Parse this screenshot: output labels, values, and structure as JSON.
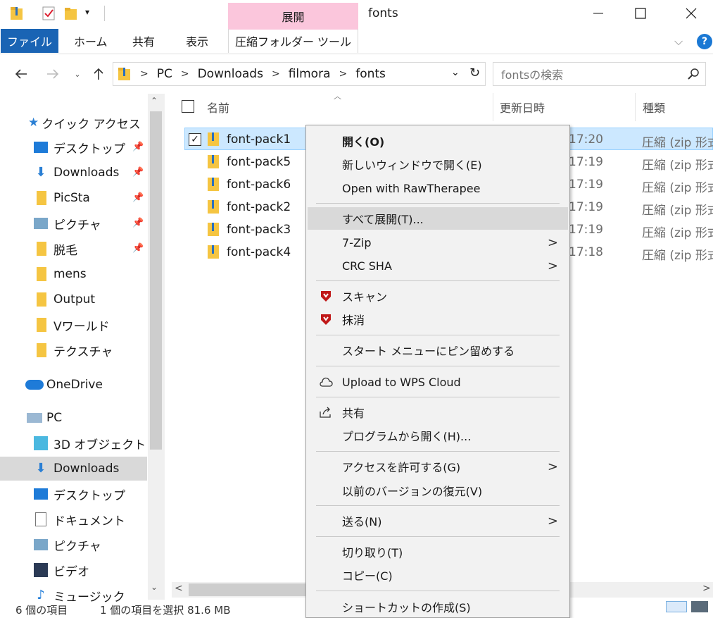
{
  "window": {
    "title": "fonts",
    "minimize": "—",
    "maximize": "☐",
    "close": "✕"
  },
  "ribbon": {
    "file_tab": "ファイル",
    "tabs": [
      "ホーム",
      "共有",
      "表示"
    ],
    "context_group": "展開",
    "context_tab": "圧縮フォルダー ツール",
    "help": "?"
  },
  "address": {
    "crumbs": [
      "PC",
      "Downloads",
      "filmora",
      "fonts"
    ],
    "search_placeholder": "fontsの検索"
  },
  "nav": {
    "quick_access": "クイック アクセス",
    "quick_items": [
      "デスクトップ",
      "Downloads",
      "PicSta",
      "ピクチャ",
      "脱毛",
      "mens",
      "Output",
      "Vワールド",
      "テクスチャ"
    ],
    "onedrive": "OneDrive",
    "pc": "PC",
    "pc_items": [
      "3D オブジェクト",
      "Downloads",
      "デスクトップ",
      "ドキュメント",
      "ピクチャ",
      "ビデオ",
      "ミュージック"
    ]
  },
  "list": {
    "columns": [
      "名前",
      "更新日時",
      "種類"
    ],
    "files": [
      {
        "name": "font-pack1",
        "time": "17:20",
        "type": "圧縮 (zip 形式"
      },
      {
        "name": "font-pack5",
        "time": "17:19",
        "type": "圧縮 (zip 形式"
      },
      {
        "name": "font-pack6",
        "time": "17:19",
        "type": "圧縮 (zip 形式"
      },
      {
        "name": "font-pack2",
        "time": "17:19",
        "type": "圧縮 (zip 形式"
      },
      {
        "name": "font-pack3",
        "time": "17:19",
        "type": "圧縮 (zip 形式"
      },
      {
        "name": "font-pack4",
        "time": "17:18",
        "type": "圧縮 (zip 形式"
      }
    ]
  },
  "status": {
    "count": "6 個の項目",
    "selection": "1 個の項目を選択 81.6 MB"
  },
  "menu": {
    "open": "開く(O)",
    "open_new_window": "新しいウィンドウで開く(E)",
    "open_rawtherapee": "Open with RawTherapee",
    "extract_all": "すべて展開(T)...",
    "seven_zip": "7-Zip",
    "crc_sha": "CRC SHA",
    "scan": "スキャン",
    "shred": "抹消",
    "pin_start": "スタート メニューにピン留めする",
    "upload_wps": "Upload to WPS Cloud",
    "share": "共有",
    "open_with": "プログラムから開く(H)...",
    "give_access": "アクセスを許可する(G)",
    "restore_versions": "以前のバージョンの復元(V)",
    "send_to": "送る(N)",
    "cut": "切り取り(T)",
    "copy": "コピー(C)",
    "create_shortcut": "ショートカットの作成(S)"
  },
  "colors": {
    "accent": "#1a64b4",
    "context_tab": "#fbc6dc",
    "selection": "#cce8ff",
    "mcafee": "#c01818"
  }
}
